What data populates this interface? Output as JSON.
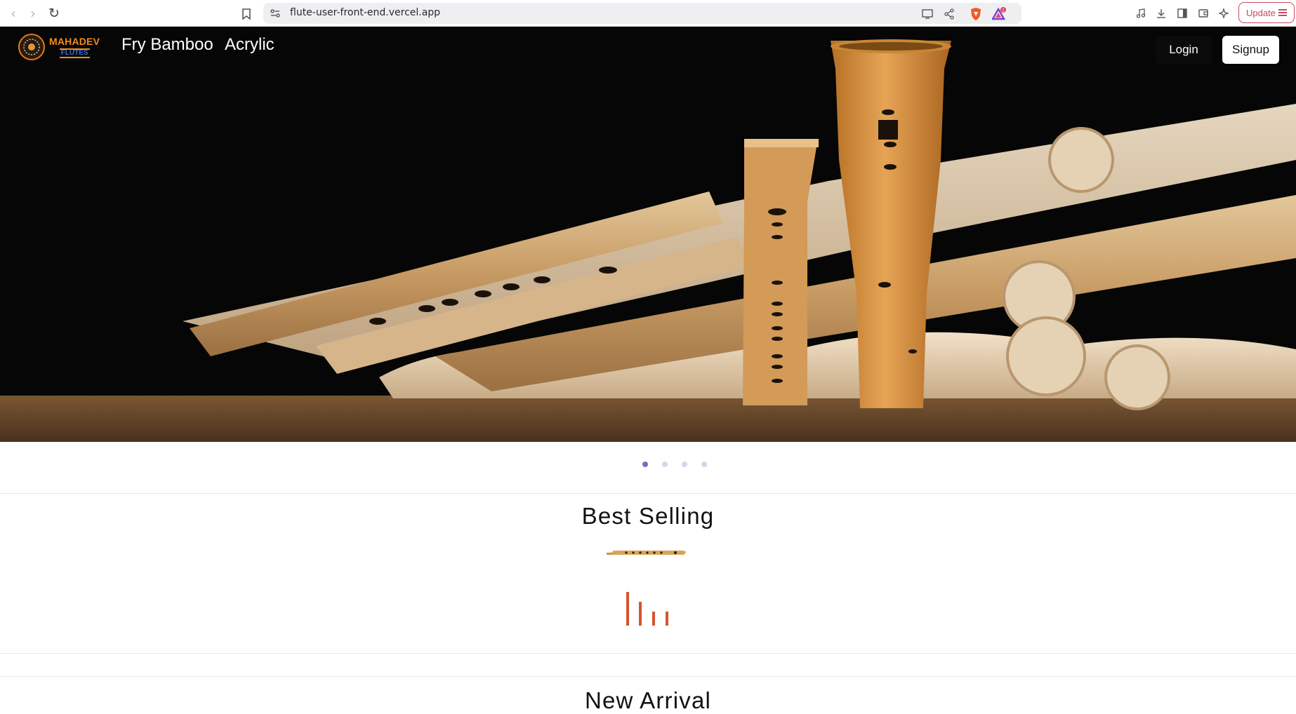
{
  "browser": {
    "url": "flute-user-front-end.vercel.app",
    "update_label": "Update",
    "icons": [
      "back-icon",
      "forward-icon",
      "reload-icon",
      "bookmark-icon",
      "site-info-icon",
      "cast-icon",
      "share-icon",
      "brave-shields-icon",
      "brave-rewards-icon",
      "media-icon",
      "download-icon",
      "sidebar-icon",
      "wallet-icon",
      "leo-ai-icon",
      "menu-icon"
    ],
    "rewards_badge": "1"
  },
  "site": {
    "logo_top": "MAHADEV",
    "logo_bottom": "FLUTES",
    "nav": [
      "Fry Bamboo",
      "Acrylic"
    ],
    "login_label": "Login",
    "signup_label": "Signup"
  },
  "carousel": {
    "slide_count": 4,
    "active_index": 0
  },
  "sections": {
    "best_selling": "Best Selling",
    "new_arrival": "New Arrival"
  },
  "colors": {
    "accent": "#d6532e",
    "dot_active": "#6d71c4",
    "dot_inactive": "#d2d5ec",
    "update": "#c8475e"
  }
}
